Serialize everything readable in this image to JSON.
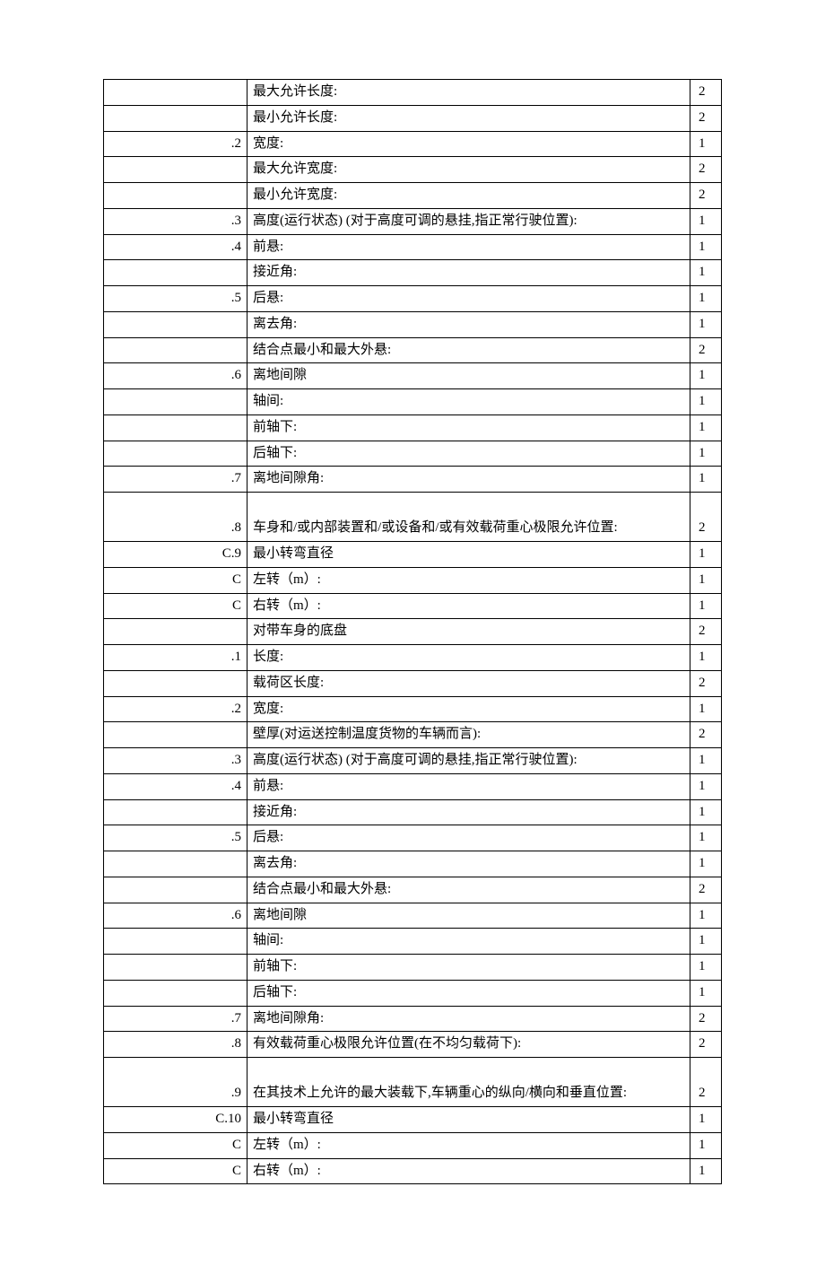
{
  "rows": [
    {
      "code": "",
      "desc": "最大允许长度:",
      "val": "2"
    },
    {
      "code": "",
      "desc": "最小允许长度:",
      "val": "2"
    },
    {
      "code": ".2",
      "desc": "宽度:",
      "val": "1"
    },
    {
      "code": "",
      "desc": "最大允许宽度:",
      "val": "2"
    },
    {
      "code": "",
      "desc": "最小允许宽度:",
      "val": "2"
    },
    {
      "code": ".3",
      "desc": "高度(运行状态) (对于高度可调的悬挂,指正常行驶位置):",
      "val": "1"
    },
    {
      "code": ".4",
      "desc": "前悬:",
      "val": "1"
    },
    {
      "code": "",
      "desc": "接近角:",
      "val": "1"
    },
    {
      "code": ".5",
      "desc": "后悬:",
      "val": "1"
    },
    {
      "code": "",
      "desc": "离去角:",
      "val": "1"
    },
    {
      "code": "",
      "desc": "结合点最小和最大外悬:",
      "val": "2"
    },
    {
      "code": ".6",
      "desc": "离地间隙",
      "val": "1"
    },
    {
      "code": "",
      "desc": "轴间:",
      "val": "1"
    },
    {
      "code": "",
      "desc": "前轴下:",
      "val": "1"
    },
    {
      "code": "",
      "desc": "后轴下:",
      "val": "1"
    },
    {
      "code": ".7",
      "desc": "离地间隙角:",
      "val": "1"
    },
    {
      "code": ".8",
      "desc": "车身和/或内部装置和/或设备和/或有效载荷重心极限允许位置:",
      "val": "2",
      "tall": true
    },
    {
      "code": "C.9",
      "desc": "最小转弯直径",
      "val": "1"
    },
    {
      "code": "C",
      "desc": "左转（m）:",
      "val": "1"
    },
    {
      "code": "C",
      "desc": "右转（m）:",
      "val": "1"
    },
    {
      "code": "",
      "desc": "对带车身的底盘",
      "val": "2"
    },
    {
      "code": ".1",
      "desc": "长度:",
      "val": "1"
    },
    {
      "code": "",
      "desc": "载荷区长度:",
      "val": "2"
    },
    {
      "code": ".2",
      "desc": "宽度:",
      "val": "1"
    },
    {
      "code": "",
      "desc": "壁厚(对运送控制温度货物的车辆而言):",
      "val": "2"
    },
    {
      "code": ".3",
      "desc": "高度(运行状态) (对于高度可调的悬挂,指正常行驶位置):",
      "val": "1"
    },
    {
      "code": ".4",
      "desc": "前悬:",
      "val": "1"
    },
    {
      "code": "",
      "desc": "接近角:",
      "val": "1"
    },
    {
      "code": ".5",
      "desc": "后悬:",
      "val": "1"
    },
    {
      "code": "",
      "desc": "离去角:",
      "val": "1"
    },
    {
      "code": "",
      "desc": "结合点最小和最大外悬:",
      "val": "2"
    },
    {
      "code": ".6",
      "desc": "离地间隙",
      "val": "1"
    },
    {
      "code": "",
      "desc": "轴间:",
      "val": "1"
    },
    {
      "code": "",
      "desc": "前轴下:",
      "val": "1"
    },
    {
      "code": "",
      "desc": "后轴下:",
      "val": "1"
    },
    {
      "code": ".7",
      "desc": "离地间隙角:",
      "val": "2"
    },
    {
      "code": ".8",
      "desc": "有效载荷重心极限允许位置(在不均匀载荷下):",
      "val": "2"
    },
    {
      "code": ".9",
      "desc": "在其技术上允许的最大装载下,车辆重心的纵向/横向和垂直位置:",
      "val": "2",
      "tall": true
    },
    {
      "code": "C.10",
      "desc": "最小转弯直径",
      "val": "1"
    },
    {
      "code": "C",
      "desc": "左转（m）:",
      "val": "1"
    },
    {
      "code": "C",
      "desc": "右转（m）:",
      "val": "1"
    }
  ]
}
